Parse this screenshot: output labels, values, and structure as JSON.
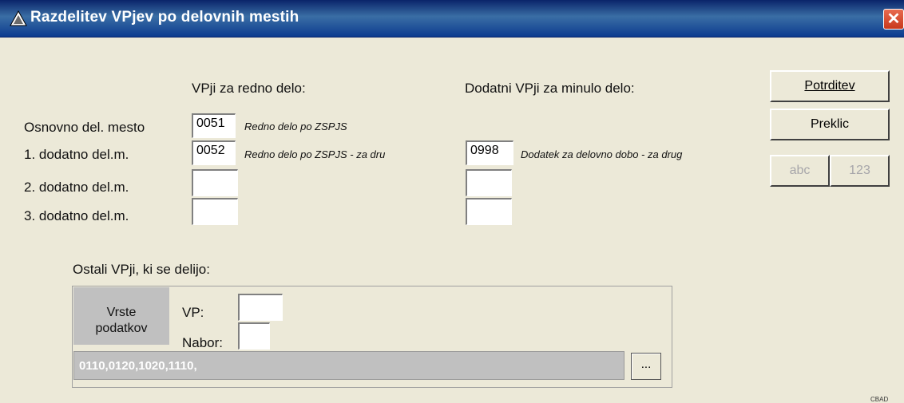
{
  "window": {
    "title": "Razdelitev VPjev po delovnih mestih",
    "title_icon": "warning-triangle-icon",
    "close_icon": "close-x-icon",
    "close_glyph": "✕"
  },
  "headers": {
    "redno": "VPji za redno delo:",
    "dodatni": "Dodatni VPji za minulo delo:"
  },
  "rows": [
    {
      "label": "Osnovno del. mesto",
      "redno_code": "0051",
      "redno_desc": "Redno delo po ZSPJS",
      "dod_code": "",
      "dod_desc": ""
    },
    {
      "label": "1. dodatno del.m.",
      "redno_code": "0052",
      "redno_desc": "Redno delo po ZSPJS - za dru",
      "dod_code": "0998",
      "dod_desc": "Dodatek za delovno dobo - za drug"
    },
    {
      "label": "2. dodatno del.m.",
      "redno_code": "",
      "redno_desc": "",
      "dod_code": "",
      "dod_desc": ""
    },
    {
      "label": "3. dodatno del.m.",
      "redno_code": "",
      "redno_desc": "",
      "dod_code": "",
      "dod_desc": ""
    }
  ],
  "buttons": {
    "confirm": "Potrditev",
    "cancel": "Preklic",
    "abc": "abc",
    "num": "123"
  },
  "ostali": {
    "label": "Ostali VPji, ki se delijo:",
    "vrste_line1": "Vrste",
    "vrste_line2": "podatkov",
    "vp_label": "VP:",
    "nabor_label": "Nabor:",
    "vp_value": "",
    "nabor_value": "",
    "list_value": "0110,0120,1020,1110,",
    "browse_label": "..."
  },
  "corner_text": "CBAD"
}
